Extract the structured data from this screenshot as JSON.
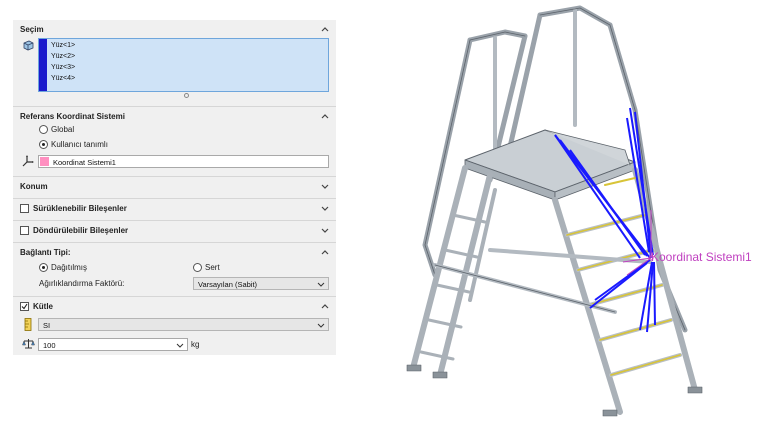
{
  "selection": {
    "title": "Seçim",
    "faces": [
      "Yüz<1>",
      "Yüz<2>",
      "Yüz<3>",
      "Yüz<4>"
    ]
  },
  "reference": {
    "title": "Referans Koordinat Sistemi",
    "option_global": "Global",
    "option_user": "Kullanıcı tanımlı",
    "selected": "Kullanıcı tanımlı",
    "coord_system": "Koordinat Sistemi1"
  },
  "position": {
    "title": "Konum"
  },
  "draggable": {
    "label": "Sürüklenebilir Bileşenler",
    "checked": false
  },
  "rotatable": {
    "label": "Döndürülebilir Bileşenler",
    "checked": false
  },
  "connection": {
    "title": "Bağlantı Tipi:",
    "option_distributed": "Dağıtılmış",
    "option_rigid": "Sert",
    "selected": "Dağıtılmış",
    "weight_label": "Ağırlıklandırma Faktörü:",
    "weight_value": "Varsayılan (Sabit)"
  },
  "mass": {
    "label": "Kütle",
    "checked": true,
    "unit_system": "SI",
    "value": "100",
    "unit": "kg"
  },
  "viewport": {
    "coord_label": "Koordinat Sistemi1"
  },
  "colors": {
    "selection_bar": "#1a1acc",
    "list_bg": "#cfe3f7",
    "coord_swatch": "#ff8fc0",
    "force_lines": "#1a1aff",
    "coord_label": "#c040c0"
  }
}
